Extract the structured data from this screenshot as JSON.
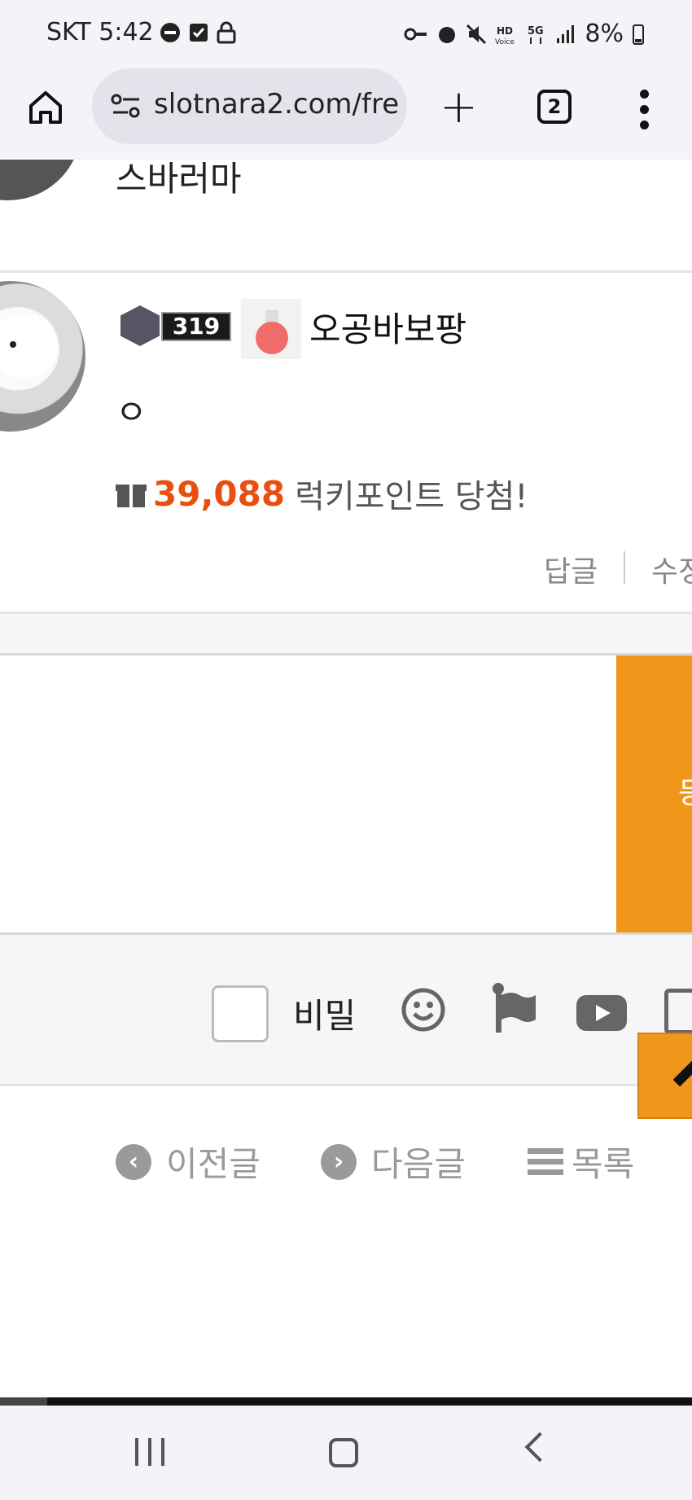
{
  "status_bar": {
    "carrier_time": "SKT 5:42",
    "battery": "8%",
    "icons_left": [
      "do-not-disturb-icon",
      "checkbox-icon",
      "lock-icon"
    ],
    "icons_right": [
      "key-icon",
      "alarm-icon",
      "mute-icon",
      "hd-voice-icon",
      "5g-icon",
      "signal-icon",
      "battery-icon"
    ]
  },
  "browser": {
    "url": "slotnara2.com/fre",
    "tab_count": "2"
  },
  "comments": [
    {
      "author": "스바러마"
    },
    {
      "level": "319",
      "author": "오공바보팡",
      "body": "ㅇ",
      "lucky_points": "39,088",
      "lucky_text": "럭키포인트 당첨!",
      "reply_label": "답글",
      "edit_label": "수정"
    }
  ],
  "comment_form": {
    "submit_label": "등",
    "secret_label": "비밀"
  },
  "post_nav": {
    "prev_label": "이전글",
    "next_label": "다음글",
    "list_label": "목록"
  },
  "colors": {
    "accent_orange": "#f0961a",
    "points_orange": "#ea4f10"
  }
}
